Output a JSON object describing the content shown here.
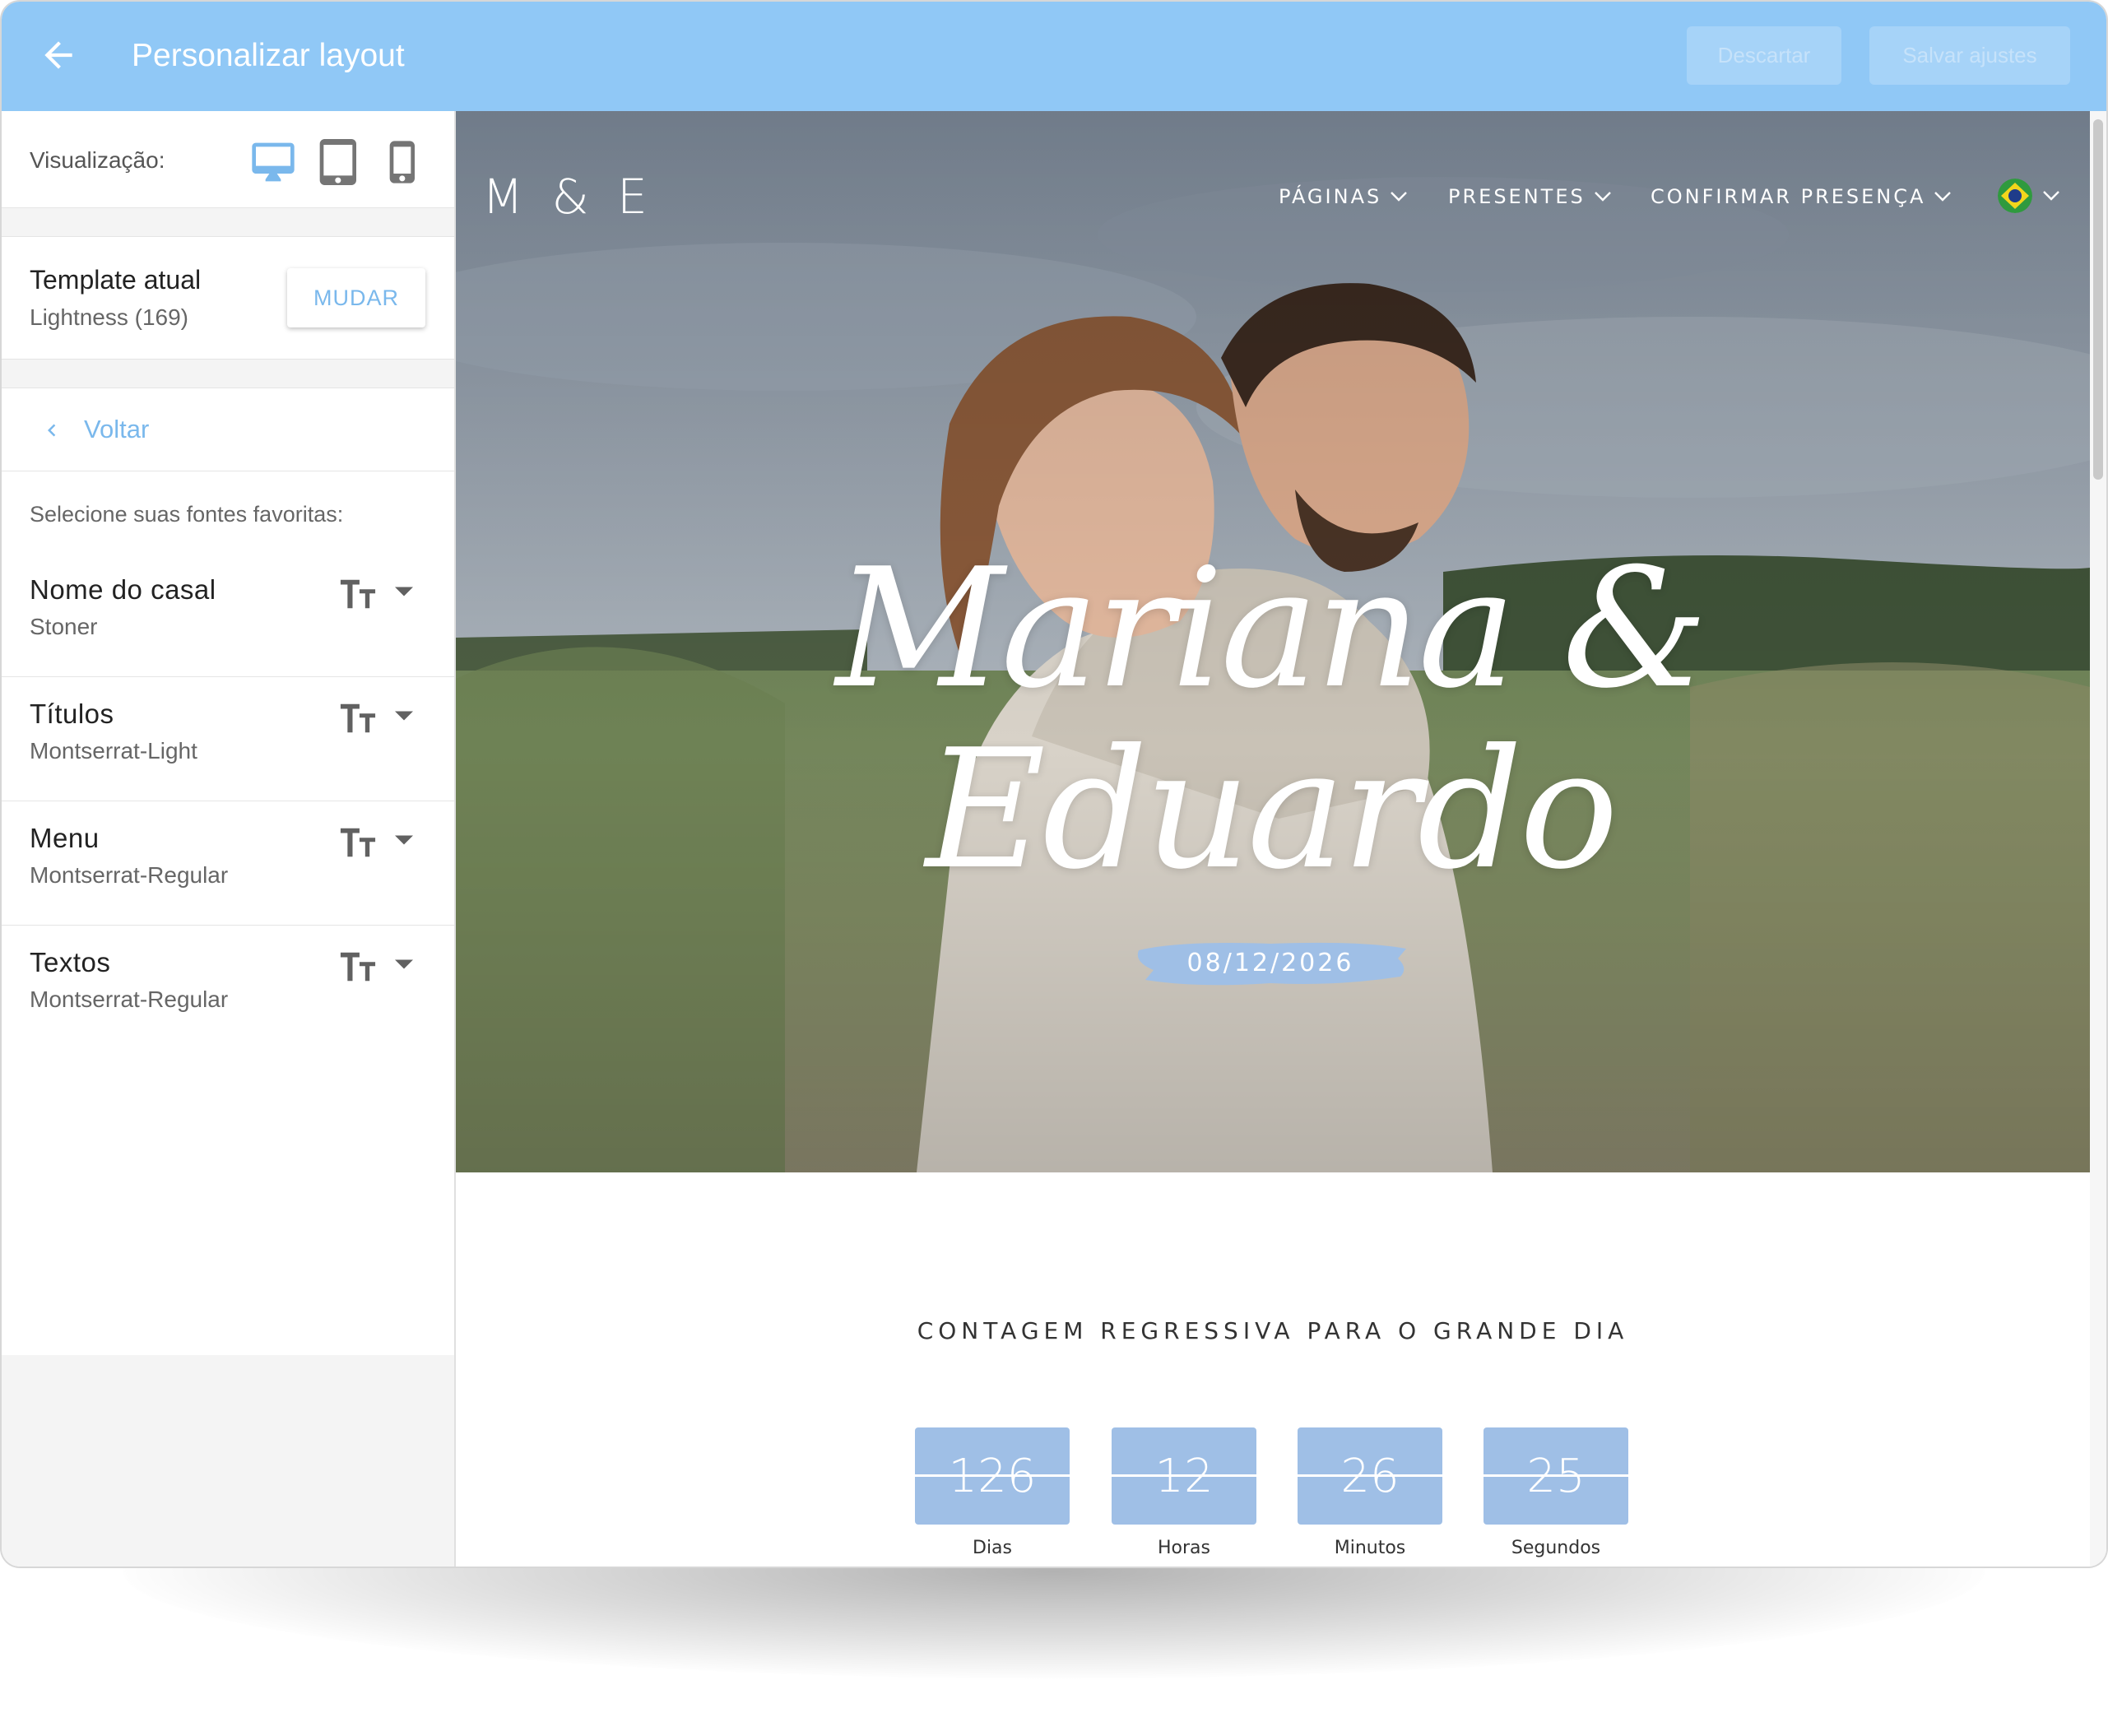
{
  "topbar": {
    "title": "Personalizar layout",
    "discard_label": "Descartar",
    "save_label": "Salvar ajustes",
    "color": "#90c8f6"
  },
  "sidebar": {
    "view_label": "Visualização:",
    "view_modes": [
      "desktop-icon",
      "tablet-icon",
      "mobile-icon"
    ],
    "active_view": "desktop",
    "template_title": "Template atual",
    "template_value": "Lightness (169)",
    "change_label": "MUDAR",
    "back_label": "Voltar",
    "fonts_intro": "Selecione suas fontes favoritas:",
    "font_settings": [
      {
        "name": "Nome do casal",
        "value": "Stoner"
      },
      {
        "name": "Títulos",
        "value": "Montserrat-Light"
      },
      {
        "name": "Menu",
        "value": "Montserrat-Regular"
      },
      {
        "name": "Textos",
        "value": "Montserrat-Regular"
      }
    ]
  },
  "site": {
    "logo": "M & E",
    "nav": [
      "PÁGINAS",
      "PRESENTES",
      "CONFIRMAR PRESENÇA"
    ],
    "language_flag": "brazil-flag-icon",
    "couple_names": "Mariana & Eduardo",
    "date": "08/12/2026",
    "countdown_title": "CONTAGEM REGRESSIVA PARA O GRANDE DIA",
    "countdown": [
      {
        "value": "126",
        "label": "Dias"
      },
      {
        "value": "12",
        "label": "Horas"
      },
      {
        "value": "26",
        "label": "Minutos"
      },
      {
        "value": "25",
        "label": "Segundos"
      }
    ],
    "accent_color": "#9fbfe6"
  }
}
